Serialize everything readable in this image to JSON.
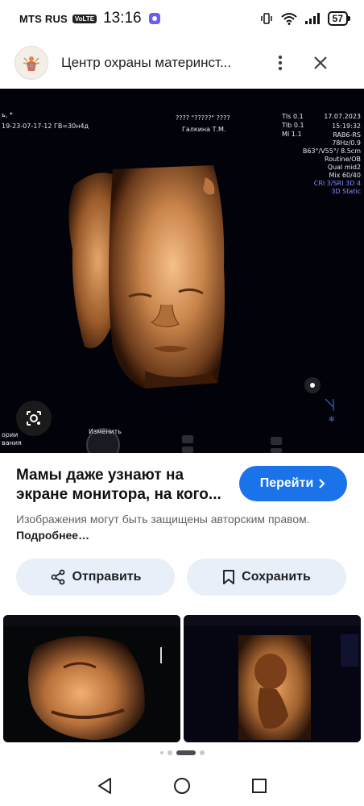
{
  "status_bar": {
    "carrier": "MTS RUS",
    "volte": "VoLTE",
    "time": "13:16",
    "battery": "57",
    "icons": [
      "message-icon",
      "vibrate-icon",
      "wifi-icon",
      "signal-icon",
      "battery-icon"
    ]
  },
  "header": {
    "title": "Центр охраны материнст...",
    "icons": [
      "site-logo",
      "more-vert-icon",
      "close-icon"
    ]
  },
  "main_image": {
    "description_icon": "lens-icon",
    "overlay_text": {
      "top_left_1": "ь, *",
      "top_left_2": "19-23-07-17-12  ГВ=30н4д",
      "center_1": "???? \"?????\" ????",
      "center_2": "Галкина Т.М.",
      "tis": "TIs  0.1",
      "tib": "TIb  0.1",
      "mi": "MI   1.1",
      "date": "17.07.2023",
      "time": "15:19:32",
      "probe": "RAB6-RS",
      "freq": "78Hz/0.9",
      "angle": "B63°/V55°/ 8.5cm",
      "preset": "Routine/OB",
      "qual": "Qual mid2",
      "mix": "Mix 60/40",
      "cri": "CRI 3/SRI 3D 4",
      "mode": "3D Static",
      "bottom_left_1": "ории",
      "bottom_left_2": "вания",
      "bottom_center": "Изменить"
    }
  },
  "result": {
    "caption": "Мамы даже узнают на экране монитора, на кого...",
    "go_button": "Перейти",
    "copyright_text": "Изображения могут быть защищены авторским правом.",
    "more_link": "Подробнее…"
  },
  "actions": {
    "share": "Отправить",
    "save": "Сохранить"
  },
  "pager": {
    "pages": 5,
    "active_index": 2
  },
  "colors": {
    "primary_button": "#1a73e8",
    "action_button_bg": "#e9eff9",
    "ultrasound_bg": "#02030a",
    "flesh_tone": "#c8844a"
  }
}
